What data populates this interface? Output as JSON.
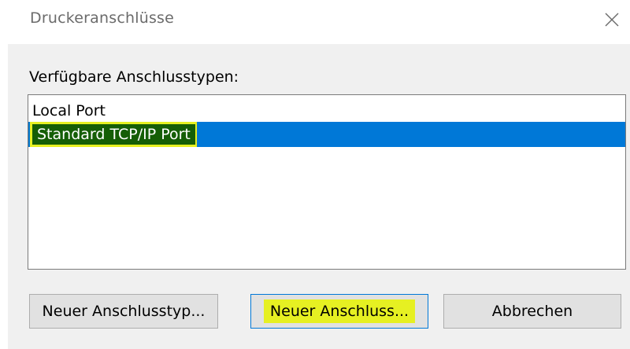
{
  "dialog": {
    "title": "Druckeranschlüsse",
    "close_icon": "close-icon"
  },
  "ports": {
    "label": "Verfügbare Anschlusstypen:",
    "items": [
      {
        "label": "Local Port",
        "selected": false
      },
      {
        "label": "Standard TCP/IP Port",
        "selected": true
      }
    ]
  },
  "buttons": {
    "new_port_type": "Neuer Anschlusstyp...",
    "new_port": "Neuer Anschluss...",
    "cancel": "Abbrechen"
  },
  "colors": {
    "selection": "#0078d7",
    "highlight": "#e6f022",
    "highlight_text_bg": "#155e06",
    "client_bg": "#f0f0f0"
  }
}
